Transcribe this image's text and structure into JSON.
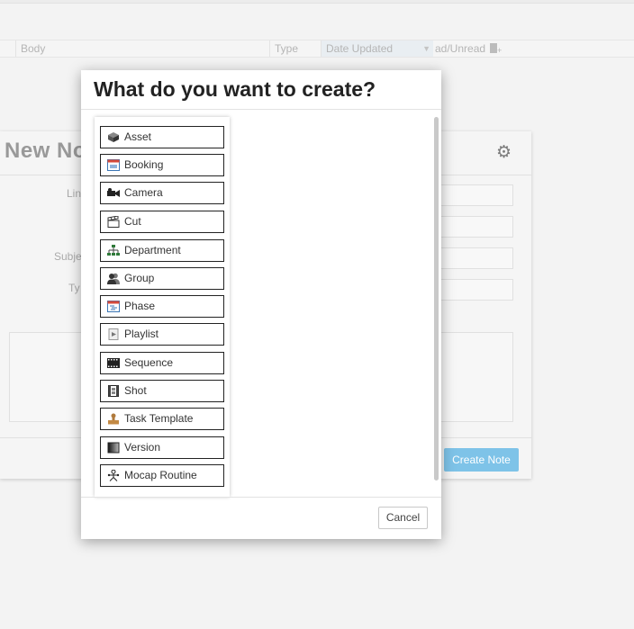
{
  "grid": {
    "columns": {
      "body": "Body",
      "type": "Type",
      "date_updated": "Date Updated",
      "read_unread": "ad/Unread"
    },
    "sort_direction": "descending"
  },
  "note_panel": {
    "title": "New No",
    "labels": {
      "links": "Lin",
      "subject": "Subje",
      "type": "Ty"
    },
    "create_button": "Create Note"
  },
  "modal": {
    "title": "What do you want to create?",
    "items": [
      {
        "label": "Asset",
        "icon": "asset-icon"
      },
      {
        "label": "Booking",
        "icon": "booking-icon"
      },
      {
        "label": "Camera",
        "icon": "camera-icon"
      },
      {
        "label": "Cut",
        "icon": "cut-icon"
      },
      {
        "label": "Department",
        "icon": "department-icon"
      },
      {
        "label": "Group",
        "icon": "group-icon"
      },
      {
        "label": "Phase",
        "icon": "phase-icon"
      },
      {
        "label": "Playlist",
        "icon": "playlist-icon"
      },
      {
        "label": "Sequence",
        "icon": "sequence-icon"
      },
      {
        "label": "Shot",
        "icon": "shot-icon"
      },
      {
        "label": "Task Template",
        "icon": "task-template-icon"
      },
      {
        "label": "Version",
        "icon": "version-icon"
      },
      {
        "label": "Mocap Routine",
        "icon": "mocap-routine-icon"
      }
    ],
    "cancel_button": "Cancel"
  },
  "colors": {
    "accent": "#7ec3e8",
    "modal_bg": "#ffffff",
    "page_bg": "#f3f3f3"
  }
}
